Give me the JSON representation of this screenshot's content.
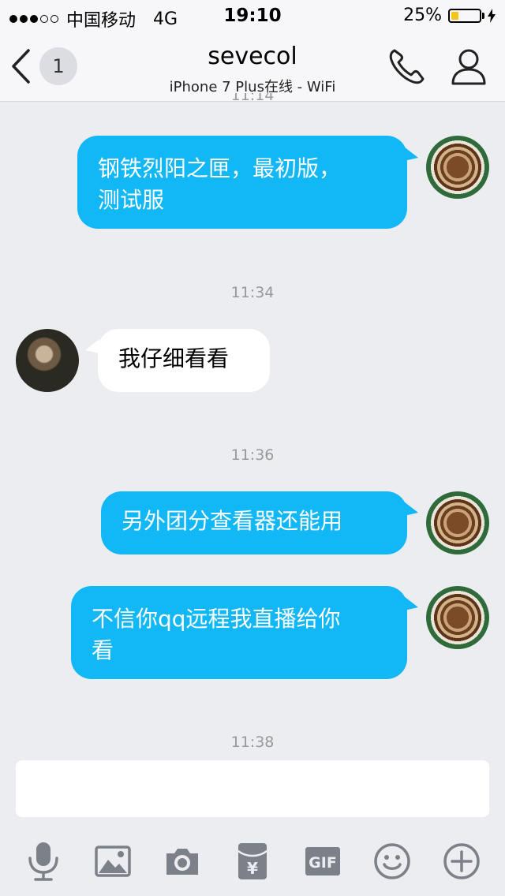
{
  "status_bar": {
    "carrier": "中国移动",
    "network": "4G",
    "time": "19:10",
    "battery": "25%",
    "battery_level": 0.25,
    "battery_color": "#f5c518"
  },
  "nav": {
    "back_icon": "chevron-left-icon",
    "unread_count": "1",
    "title": "sevecol",
    "subtitle": "iPhone 7 Plus在线 - WiFi",
    "call_icon": "phone-icon",
    "profile_icon": "user-icon"
  },
  "messages": {
    "cut_timestamp": "11:14",
    "m1": {
      "direction": "out",
      "text_line1": "钢铁烈阳之匣，最初版，",
      "text_line2": "测试服"
    },
    "ts2": "11:34",
    "m2": {
      "direction": "in",
      "text": "我仔细看看"
    },
    "ts3": "11:36",
    "m3": {
      "direction": "out",
      "text": "另外团分查看器还能用"
    },
    "m4": {
      "direction": "out",
      "text_line1": "不信你qq远程我直播给你",
      "text_line2": "看"
    },
    "ts4": "11:38"
  },
  "input": {
    "value": "",
    "placeholder": ""
  },
  "toolbar": {
    "items": [
      "microphone-icon",
      "image-icon",
      "camera-icon",
      "red-packet-icon",
      "gif-icon",
      "emoji-icon",
      "plus-icon"
    ],
    "gif_label": "GIF",
    "red_packet_symbol": "¥"
  },
  "colors": {
    "outgoing_bubble": "#12b7f5",
    "incoming_bubble": "#ffffff",
    "background": "#ebedf1",
    "icon_gray": "#7c8089"
  }
}
